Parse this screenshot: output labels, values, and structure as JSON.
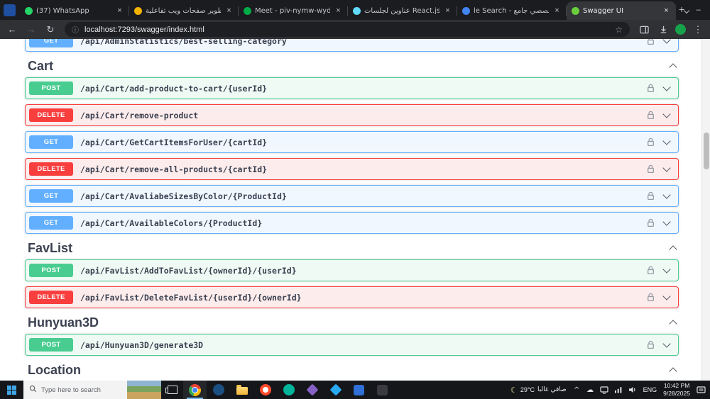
{
  "icons": {
    "back": "←",
    "forward": "→",
    "refresh": "↻",
    "site_info": "ⓘ",
    "bookmark_star": "☆",
    "menu_dots": "⋮",
    "new_tab": "+",
    "close": "×",
    "minimize": "–",
    "hidden_items": "^",
    "onedrive_cloud": "☁",
    "weather_moon": "☾"
  },
  "browser": {
    "tabs": [
      {
        "label": "(37) WhatsApp",
        "icon": "whatsapp",
        "icon_color": "#25d366",
        "active": false
      },
      {
        "label": "تطوير صفحات ويب تفاعلية",
        "icon": "docs",
        "icon_color": "#f5b301",
        "active": false
      },
      {
        "label": "Meet - piv-nymw-wyd",
        "icon": "meet",
        "icon_color": "#00ac47",
        "active": false
      },
      {
        "label": "عناوين لجلسات React.js",
        "icon": "react",
        "icon_color": "#61dafb",
        "active": false
      },
      {
        "label": "le Search - بتخصصي جامع",
        "icon": "google",
        "icon_color": "#4285f4",
        "active": false
      },
      {
        "label": "Swagger UI",
        "icon": "swagger",
        "icon_color": "#6ace3c",
        "active": true
      }
    ],
    "url": "localhost:7293/swagger/index.html"
  },
  "swagger": {
    "method_colors": {
      "GET": "#61affe",
      "POST": "#49cc90",
      "DELETE": "#f93e3e"
    },
    "partial_endpoint": {
      "method": "GET",
      "path": "/api/AdminStatistics/best-selling-category"
    },
    "sections": [
      {
        "title": "Cart",
        "endpoints": [
          {
            "method": "POST",
            "path": "/api/Cart/add-product-to-cart/{userId}"
          },
          {
            "method": "DELETE",
            "path": "/api/Cart/remove-product"
          },
          {
            "method": "GET",
            "path": "/api/Cart/GetCartItemsForUser/{cartId}"
          },
          {
            "method": "DELETE",
            "path": "/api/Cart/remove-all-products/{cartId}"
          },
          {
            "method": "GET",
            "path": "/api/Cart/AvaliabeSizesByColor/{ProductId}"
          },
          {
            "method": "GET",
            "path": "/api/Cart/AvailableColors/{ProductId}"
          }
        ]
      },
      {
        "title": "FavList",
        "endpoints": [
          {
            "method": "POST",
            "path": "/api/FavList/AddToFavList/{ownerId}/{userId}"
          },
          {
            "method": "DELETE",
            "path": "/api/FavList/DeleteFavList/{userId}/{ownerId}"
          }
        ]
      },
      {
        "title": "Hunyuan3D",
        "endpoints": [
          {
            "method": "POST",
            "path": "/api/Hunyuan3D/generate3D"
          }
        ]
      },
      {
        "title": "Location",
        "endpoints": []
      }
    ]
  },
  "taskbar": {
    "search_placeholder": "Type here to search",
    "apps": [
      {
        "name": "chrome",
        "type": "chrome",
        "color": "#4285f4",
        "active": true
      },
      {
        "name": "edge",
        "type": "circle",
        "color": "#1b4f82"
      },
      {
        "name": "file-explorer",
        "type": "folder",
        "color": "#f5c14c"
      },
      {
        "name": "opera",
        "type": "ring",
        "color": "#ff4b2b"
      },
      {
        "name": "teal-app",
        "type": "circle",
        "color": "#00b39b"
      },
      {
        "name": "visual-studio",
        "type": "diamond",
        "color": "#8661c5"
      },
      {
        "name": "vscode",
        "type": "diamond",
        "color": "#29a9f2"
      },
      {
        "name": "photos",
        "type": "square",
        "color": "#2f6fd6"
      },
      {
        "name": "terminal",
        "type": "square",
        "color": "#3a3a40"
      }
    ],
    "tray_items": [
      {
        "name": "hidden-icons-chevron",
        "glyph": "^"
      },
      {
        "name": "onedrive-cloud-icon",
        "glyph": "☁"
      },
      {
        "name": "display-icon",
        "svg": "display"
      },
      {
        "name": "network-signal-icon",
        "svg": "network"
      },
      {
        "name": "volume-icon",
        "svg": "volume"
      }
    ],
    "weather": {
      "temp": "29°C",
      "condition": "صافي غالبا"
    },
    "language": "ENG",
    "time": "10:42 PM",
    "date": "9/28/2025"
  }
}
